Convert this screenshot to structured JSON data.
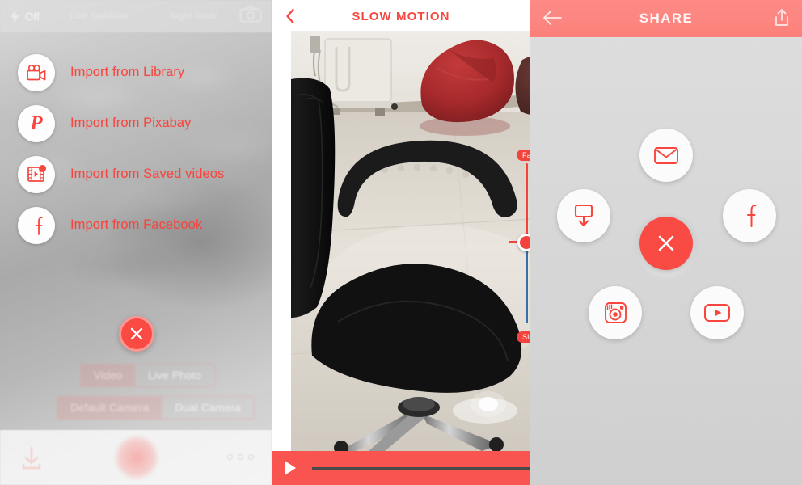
{
  "left_panel": {
    "camera_topbar": {
      "flash_icon": "flash-off-icon",
      "flash_label": "Off",
      "faint_item_1": "Live Stabilizer",
      "faint_item_2": "Night Mode",
      "flip_icon": "camera-flip-icon"
    },
    "import_options": [
      {
        "label": "Import from Library",
        "icon": "movie-camera-icon",
        "badge": false
      },
      {
        "label": "Import from Pixabay",
        "icon": "pixabay-p-icon",
        "badge": false
      },
      {
        "label": "Import from Saved videos",
        "icon": "film-strip-play-icon",
        "badge": true
      },
      {
        "label": "Import from Facebook",
        "icon": "facebook-icon",
        "badge": false
      }
    ],
    "close_button": {
      "icon": "close-x-icon",
      "label": "Close"
    },
    "mode_toggle_1": {
      "options": [
        "Video",
        "Live Photo"
      ],
      "selected": "Video"
    },
    "mode_toggle_2": {
      "options": [
        "Default Camera",
        "Dual Camera"
      ],
      "selected": "Default Camera"
    },
    "bottom_bar": {
      "download_icon": "download-icon",
      "record_button": "record-button",
      "more_icon": "three-dots-icon"
    }
  },
  "middle_panel": {
    "header": {
      "back_icon": "chevron-left-icon",
      "title": "SLOW MOTION"
    },
    "preview": {
      "alt": "video-preview-office-chair"
    },
    "speed_slider": {
      "top_label": "Fast",
      "bottom_label": "Slow",
      "handle_position_percent": 48,
      "fast_track_color": "#f4423c",
      "slow_track_color": "#3a6ea8"
    },
    "player": {
      "play_icon": "play-icon",
      "progress_percent": 0,
      "bar_color": "#fa5450"
    }
  },
  "right_panel": {
    "header": {
      "back_icon": "arrow-left-icon",
      "title": "SHARE",
      "export_icon": "share-export-icon",
      "bar_color": "#fc8681"
    },
    "share_targets": [
      {
        "name": "Email",
        "icon": "envelope-icon",
        "position": "top"
      },
      {
        "name": "Save",
        "icon": "save-download-icon",
        "position": "left"
      },
      {
        "name": "Facebook",
        "icon": "facebook-icon",
        "position": "right"
      },
      {
        "name": "Instagram",
        "icon": "instagram-icon",
        "position": "bottom-left"
      },
      {
        "name": "YouTube",
        "icon": "youtube-icon",
        "position": "bottom-right"
      }
    ],
    "close_button": {
      "icon": "close-x-icon",
      "label": "Close"
    }
  },
  "theme": {
    "accent_red": "#f8463f",
    "coral": "#fa5450",
    "header_coral": "#fc8681"
  }
}
